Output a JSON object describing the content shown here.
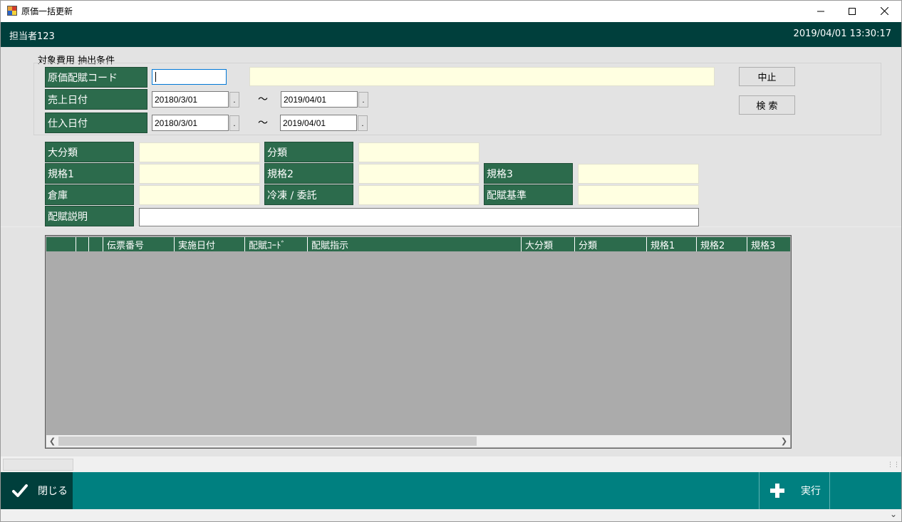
{
  "window": {
    "title": "原価一括更新"
  },
  "header": {
    "user": "担当者123",
    "datetime": "2019/04/01 13:30:17"
  },
  "conditions": {
    "title": "対象費用  抽出条件",
    "cost_code_label": "原価配賦コード",
    "cost_code_value": "",
    "sales_date_label": "売上日付",
    "sales_date_from": "20180/3/01",
    "sales_date_to": "2019/04/01",
    "purchase_date_label": "仕入日付",
    "purchase_date_from": "20180/3/01",
    "purchase_date_to": "2019/04/01",
    "tilde": "～",
    "dot": "."
  },
  "buttons": {
    "cancel": "中止",
    "search": "検 索"
  },
  "filters": {
    "major": "大分類",
    "category": "分類",
    "spec1": "規格1",
    "spec2": "規格2",
    "spec3": "規格3",
    "warehouse": "倉庫",
    "frozen": "冷凍 / 委託",
    "basis": "配賦基準",
    "description": "配賦説明"
  },
  "grid": {
    "columns": [
      "",
      "",
      "",
      "伝票番号",
      "実施日付",
      "配賦ｺｰﾄﾞ",
      "配賦指示",
      "大分類",
      "分類",
      "規格1",
      "規格2",
      "規格3"
    ]
  },
  "footer": {
    "close": "閉じる",
    "execute": "実行"
  },
  "colors": {
    "label_bg": "#2c6b4c",
    "header_bg": "#003f3c",
    "footer_bg": "#008080",
    "input_yellow": "#ffffe1"
  }
}
